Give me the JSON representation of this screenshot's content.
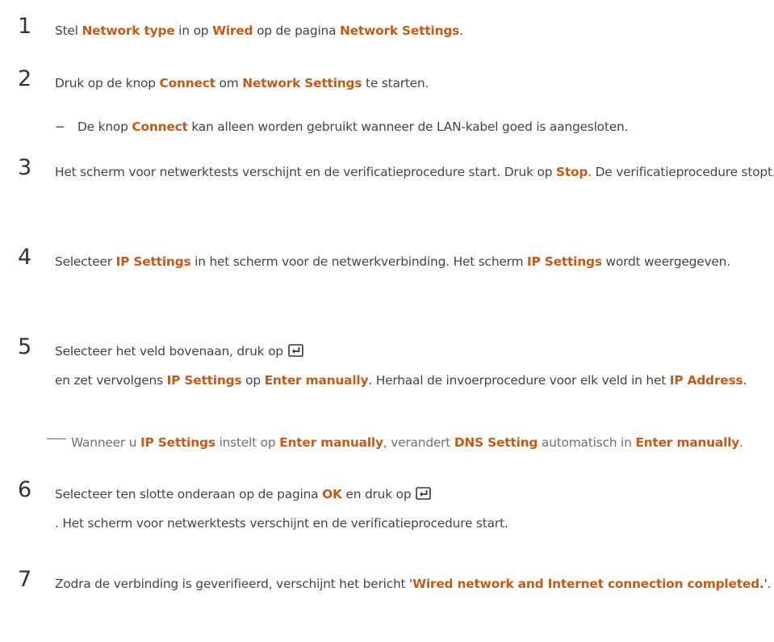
{
  "steps": [
    {
      "num": "1",
      "parts": [
        {
          "t": "Stel "
        },
        {
          "b": "Network type"
        },
        {
          "t": " in op "
        },
        {
          "b": "Wired"
        },
        {
          "t": " op de pagina "
        },
        {
          "b": "Network Settings"
        },
        {
          "t": "."
        }
      ]
    },
    {
      "num": "2",
      "parts": [
        {
          "t": "Druk op de knop "
        },
        {
          "b": "Connect"
        },
        {
          "t": " om "
        },
        {
          "b": "Network Settings"
        },
        {
          "t": " te starten."
        }
      ],
      "sub": {
        "dash": "−",
        "parts": [
          {
            "t": "De knop "
          },
          {
            "b": "Connect"
          },
          {
            "t": " kan alleen worden gebruikt wanneer de LAN-kabel goed is aangesloten."
          }
        ]
      }
    },
    {
      "num": "3",
      "parts": [
        {
          "t": "Het scherm voor netwerktests verschijnt en de verificatieprocedure start. Druk op "
        },
        {
          "b": "Stop"
        },
        {
          "t": ". De verificatieprocedure stopt."
        }
      ]
    },
    {
      "num": "4",
      "parts": [
        {
          "t": "Selecteer "
        },
        {
          "b": "IP Settings"
        },
        {
          "t": " in het scherm voor de netwerkverbinding. Het scherm "
        },
        {
          "b": "IP Settings"
        },
        {
          "t": " wordt weergegeven."
        }
      ]
    },
    {
      "num": "5",
      "parts": [
        {
          "t": "Selecteer het veld bovenaan, druk op"
        },
        {
          "icon": "enter-icon"
        },
        {
          "t": "en zet vervolgens "
        },
        {
          "b": "IP Settings"
        },
        {
          "t": " op "
        },
        {
          "b": "Enter manually"
        },
        {
          "t": ". Herhaal de invoerprocedure voor elk veld in het "
        },
        {
          "b": "IP Address"
        },
        {
          "t": "."
        }
      ],
      "note": {
        "parts": [
          {
            "t": "Wanneer u "
          },
          {
            "b": "IP Settings"
          },
          {
            "t": " instelt op "
          },
          {
            "b": "Enter manually"
          },
          {
            "t": ", verandert "
          },
          {
            "b": "DNS Setting"
          },
          {
            "t": " automatisch in "
          },
          {
            "b": "Enter manually"
          },
          {
            "t": "."
          }
        ]
      }
    },
    {
      "num": "6",
      "parts": [
        {
          "t": "Selecteer ten slotte onderaan op de pagina "
        },
        {
          "b": "OK"
        },
        {
          "t": " en druk op"
        },
        {
          "icon": "enter-icon"
        },
        {
          "t": ". Het scherm voor netwerktests verschijnt en de verificatieprocedure start."
        }
      ]
    },
    {
      "num": "7",
      "parts": [
        {
          "t": "Zodra de verbinding is geverifieerd, verschijnt het bericht '"
        },
        {
          "b": "Wired network and Internet connection completed."
        },
        {
          "t": "'."
        }
      ]
    }
  ]
}
